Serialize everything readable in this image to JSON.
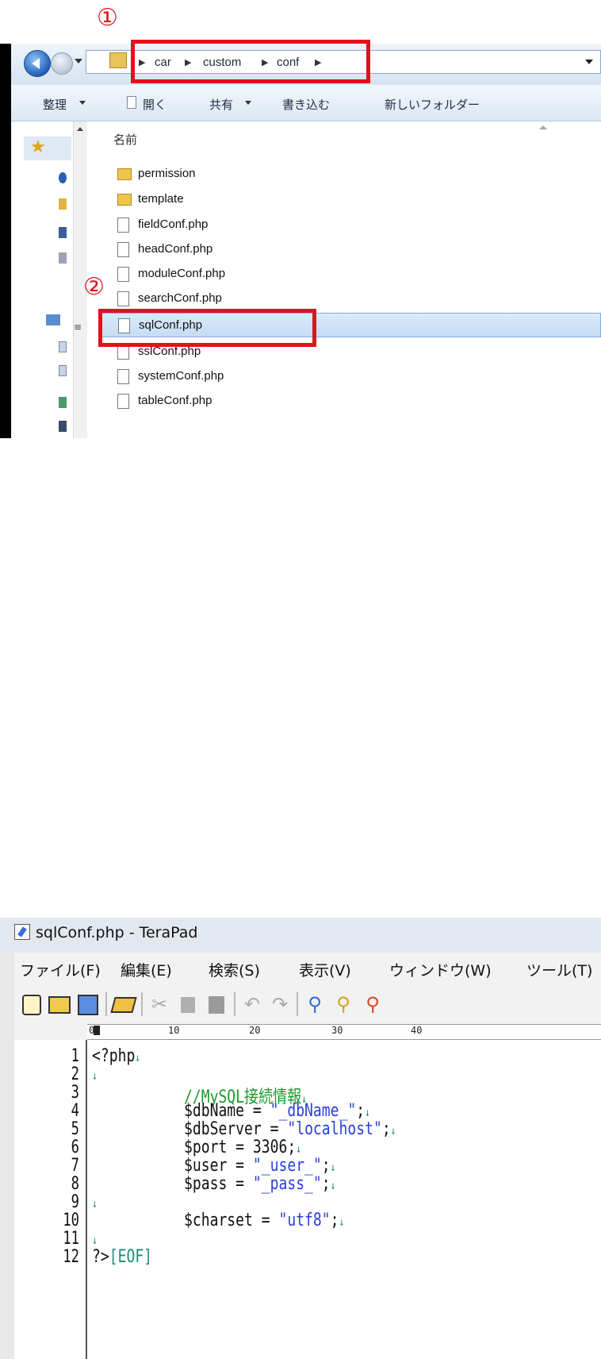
{
  "explorer": {
    "breadcrumb": [
      "car",
      "custom",
      "conf"
    ],
    "toolbar": {
      "organize": "整理",
      "open": "開く",
      "share": "共有",
      "burn": "書き込む",
      "new_folder": "新しいフォルダー"
    },
    "column_header": "名前",
    "files": [
      {
        "name": "permission",
        "type": "folder"
      },
      {
        "name": "template",
        "type": "folder"
      },
      {
        "name": "fieldConf.php",
        "type": "file"
      },
      {
        "name": "headConf.php",
        "type": "file"
      },
      {
        "name": "moduleConf.php",
        "type": "file"
      },
      {
        "name": "searchConf.php",
        "type": "file"
      },
      {
        "name": "sqlConf.php",
        "type": "file",
        "selected": true
      },
      {
        "name": "sslConf.php",
        "type": "file"
      },
      {
        "name": "systemConf.php",
        "type": "file"
      },
      {
        "name": "tableConf.php",
        "type": "file"
      }
    ]
  },
  "annotations": {
    "step1": "①",
    "step2": "②",
    "color": "#e3101d"
  },
  "terapad": {
    "title": "sqlConf.php - TeraPad",
    "menu": [
      "ファイル(F)",
      "編集(E)",
      "検索(S)",
      "表示(V)",
      "ウィンドウ(W)",
      "ツール(T)"
    ],
    "ruler_labels": [
      "0",
      "10",
      "20",
      "30",
      "40"
    ],
    "line_numbers": [
      "1",
      "2",
      "3",
      "4",
      "5",
      "6",
      "7",
      "8",
      "9",
      "10",
      "11",
      "12"
    ],
    "code": {
      "l1": "<?php",
      "l3_comment": "//MySQL接続情報",
      "l4_var": "$dbName = ",
      "l4_str": "\"_dbName_\"",
      "l5_var": "$dbServer = ",
      "l5_str": "\"localhost\"",
      "l6": "$port = 3306;",
      "l7_var": "$user = ",
      "l7_str": "\"_user_\"",
      "l8_var": "$pass = ",
      "l8_str": "\"_pass_\"",
      "l10_var": "$charset = ",
      "l10_str": "\"utf8\"",
      "l12": "?>",
      "eof": "[EOF]",
      "semicolon": ";",
      "eol_mark": "↓"
    },
    "toolbar_icons": [
      "new-file-icon",
      "open-folder-icon",
      "save-icon",
      "print-icon",
      "cut-icon",
      "copy-icon",
      "paste-icon",
      "undo-icon",
      "redo-icon",
      "find-icon",
      "find-next-icon",
      "replace-icon"
    ]
  }
}
